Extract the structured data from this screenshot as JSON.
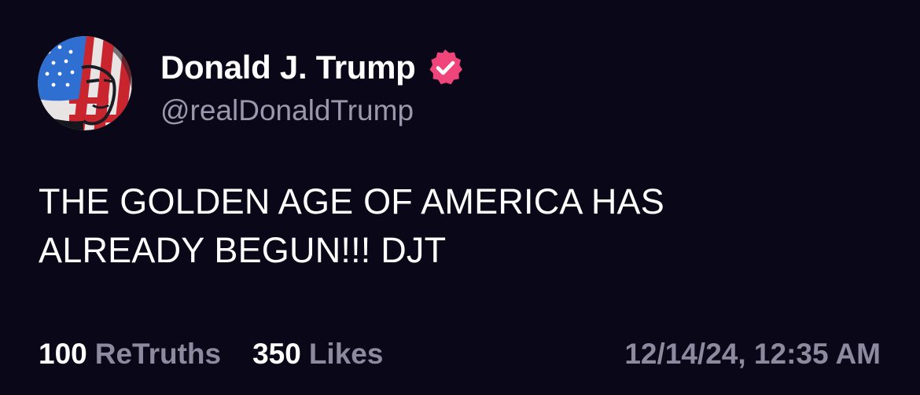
{
  "author": {
    "display_name": "Donald J. Trump",
    "handle": "@realDonaldTrump",
    "verified_icon": "verified-badge-icon",
    "verified_color": "#f0457a",
    "avatar_icon": "flag-portrait-avatar"
  },
  "post": {
    "line1": "THE GOLDEN AGE OF AMERICA HAS",
    "line2": "ALREADY BEGUN!!! DJT"
  },
  "stats": {
    "retruths_count": "100",
    "retruths_label": "ReTruths",
    "likes_count": "350",
    "likes_label": "Likes"
  },
  "timestamp": "12/14/24, 12:35 AM",
  "colors": {
    "background": "#0a0818",
    "text": "#ffffff",
    "muted": "#8d8a9f"
  }
}
